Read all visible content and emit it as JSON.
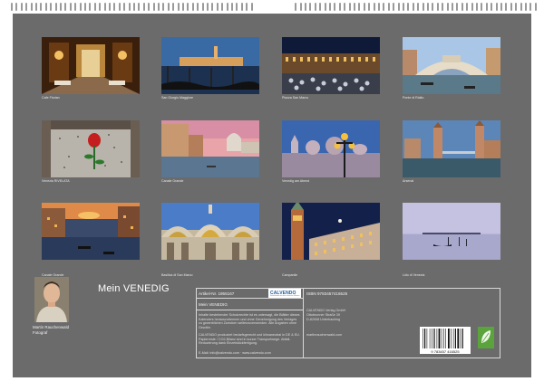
{
  "calendar": {
    "title": "Mein VENEDIG",
    "author": "Martin Rauchenwald",
    "author_role": "Fotograf"
  },
  "photos": [
    {
      "caption": "Cafe Florian"
    },
    {
      "caption": "San Giorgio Maggiore"
    },
    {
      "caption": "Piazza San Marco"
    },
    {
      "caption": "Ponte di Rialto"
    },
    {
      "caption": "Venezia RIVELATA"
    },
    {
      "caption": "Canale Grande"
    },
    {
      "caption": "Venedig am Abend"
    },
    {
      "caption": "Arsenal"
    },
    {
      "caption": "Canale Grande"
    },
    {
      "caption": "Basilica di San Marco"
    },
    {
      "caption": "Campanile"
    },
    {
      "caption": "Lido di Venezia"
    }
  ],
  "info": {
    "article_no": "Artikel-Nr. 1955167",
    "name": "Mein VENEDIG",
    "isbn": "ISBN 9783457416525",
    "publisher_name": "CALVENDO Verlag GmbH",
    "publisher_street": "Ottobrunner Straße 39",
    "publisher_city": "D-82008 Unterhaching",
    "legal_text_1": "Inhalte bestehender Schutzrechte ist es untersagt, die Blätter dieses Kalenders herauszutrennen und ohne Genehmigung des Verlages zu gewerblichen Zwecken weiterzuverwenden. Alle Angaben ohne Gewähr.",
    "legal_text_2": "CALVENDO produziert bedarfsgerecht und klimaneutral in DE & EU. Papierreste / CO2-Bilanz sind in kurzer Transportwege. Abfall-Reduzierung dank Einzelstückfertigung.",
    "email": "E-Mail: info@calvendo.com · www.calvendo.com",
    "website": "martinrauchenwald.com",
    "logo_text": "CALVENDO",
    "logo_subtext": "Fotokalender mit den schönsten Motiven",
    "barcode_number": "9 783457 416525"
  },
  "colors": {
    "card_bg": "#6b6b6b",
    "logo_blue": "#1f5c9c",
    "eco_green": "#5aa43b"
  }
}
